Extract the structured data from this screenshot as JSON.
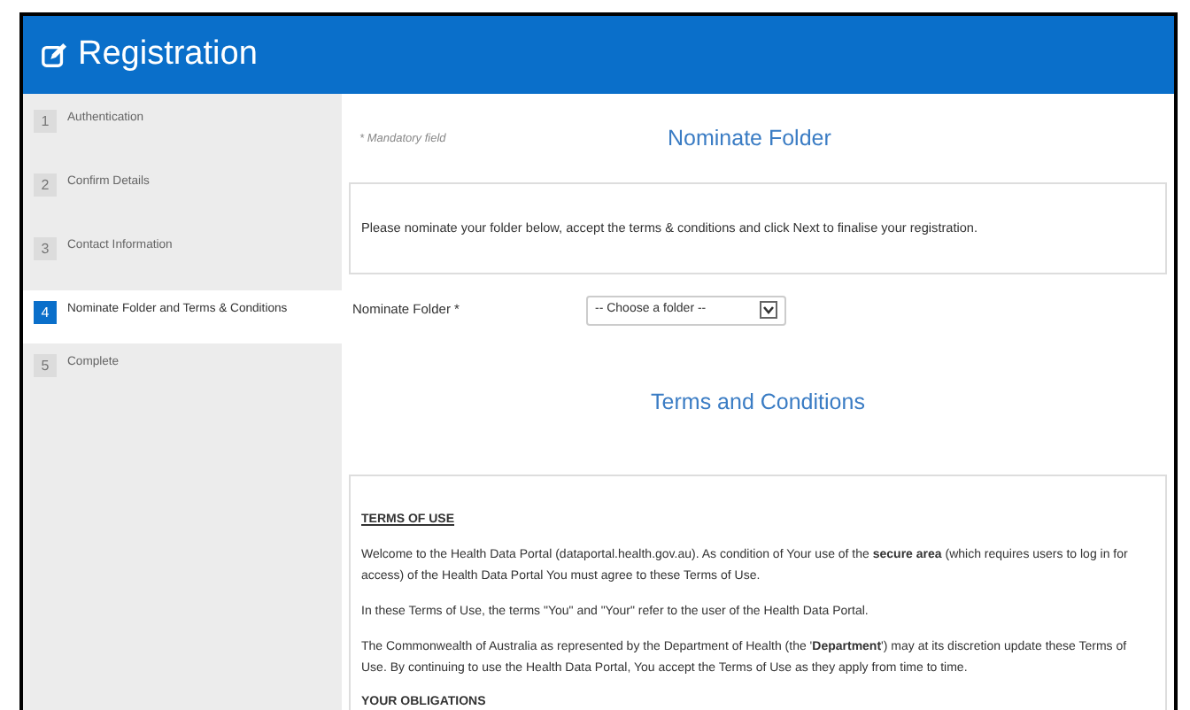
{
  "header": {
    "title": "Registration"
  },
  "steps": [
    {
      "number": "1",
      "label": "Authentication",
      "selected": false
    },
    {
      "number": "2",
      "label": "Confirm Details",
      "selected": false
    },
    {
      "number": "3",
      "label": "Contact Information",
      "selected": false
    },
    {
      "number": "4",
      "label": "Nominate Folder and Terms & Conditions",
      "selected": true
    },
    {
      "number": "5",
      "label": "Complete",
      "selected": false
    }
  ],
  "mandatory_note": "* Mandatory field",
  "section_title": "Nominate Folder",
  "instructions": "Please nominate your folder below, accept the terms & conditions and click Next to finalise your registration.",
  "folder_field": {
    "label": "Nominate Folder *",
    "placeholder": "-- Choose a folder --"
  },
  "terms_title": "Terms and Conditions",
  "terms": [
    {
      "kind": "heading",
      "text": "TERMS OF USE"
    },
    {
      "kind": "paragraph",
      "text": "Welcome to the Health Data Portal (dataportal.health.gov.au). As condition of Your use of the **secure area** (which requires users to log in for access) of the Health Data Portal You must agree to these Terms of Use."
    },
    {
      "kind": "paragraph",
      "text": "In these Terms of Use, the terms \"You\" and \"Your\" refer to the user of the Health Data Portal."
    },
    {
      "kind": "paragraph",
      "text": "The Commonwealth of Australia as represented by the Department of Health (the '**Department**') may at its discretion update these Terms of Use.  By continuing to use the Health Data Portal, You accept the Terms of Use as they apply from time to time."
    },
    {
      "kind": "subheading",
      "text": "YOUR OBLIGATIONS"
    }
  ]
}
